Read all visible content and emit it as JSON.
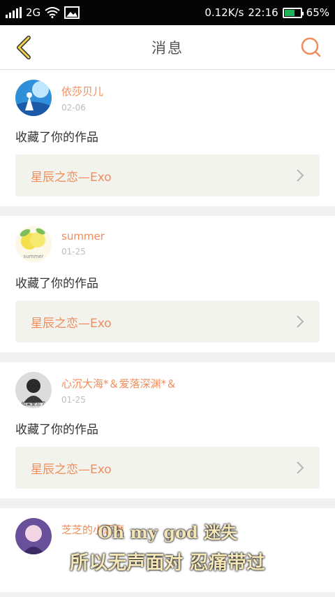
{
  "status_bar": {
    "sim_label": "1",
    "network": "2G",
    "speed": "0.12K/s",
    "time": "22:16",
    "battery_percent": "65%",
    "battery_level": 0.65,
    "battery_color": "#1fb35a"
  },
  "header": {
    "title": "消息",
    "back_icon": "chevron-left-icon",
    "search_icon": "search-icon",
    "accent": "#f08c5a"
  },
  "messages": [
    {
      "username": "依莎贝儿",
      "date": "02-06",
      "action": "收藏了你的作品",
      "work_title": "星辰之恋—Exo"
    },
    {
      "username": "summer",
      "date": "01-25",
      "action": "收藏了你的作品",
      "work_title": "星辰之恋—Exo",
      "avatar_caption": "summer"
    },
    {
      "username": "心沉大海*＆爱落深渊*＆",
      "date": "01-25",
      "action": "收藏了你的作品",
      "work_title": "星辰之恋—Exo",
      "avatar_caption": "如果爱忘了"
    },
    {
      "username": "芝芝的小恶魔",
      "date": "",
      "action": "",
      "work_title": ""
    }
  ],
  "overlay_lyrics": {
    "line1": "Oh my god 迷失",
    "line2": "所以无声面对 忍痛带过"
  }
}
